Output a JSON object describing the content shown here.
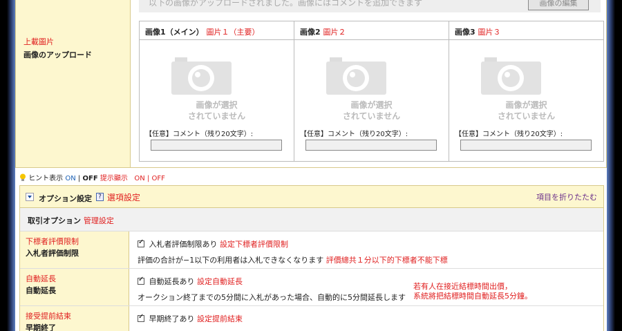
{
  "upload": {
    "label_zh": "上載圖片",
    "label_ja": "画像のアップロード",
    "notice": "以下の画像がアップロードされました。画像にはコメントを追加できます",
    "edit_button": "画像の編集",
    "images": [
      {
        "title": "画像1（メイン）",
        "title_zh": "圖片１（主要）",
        "placeholder": [
          "画像が選択",
          "されていません"
        ],
        "comment_label": "【任意】コメント（残り20文字）:"
      },
      {
        "title": "画像2",
        "title_zh": "圖片２",
        "placeholder": [
          "画像が選択",
          "されていません"
        ],
        "comment_label": "【任意】コメント（残り20文字）:"
      },
      {
        "title": "画像3",
        "title_zh": "圖片３",
        "placeholder": [
          "画像が選択",
          "されていません"
        ],
        "comment_label": "【任意】コメント（残り20文字）:"
      }
    ]
  },
  "hint": {
    "label": "ヒント表示",
    "on": "ON",
    "sep": "|",
    "off": "OFF",
    "label_zh": "提示顯示",
    "on_zh": "ON",
    "off_zh": "OFF"
  },
  "options": {
    "title": "オプション設定",
    "help": "?",
    "title_zh": "選項設定",
    "collapse": "項目を折りたたむ",
    "section": "取引オプション",
    "section_zh": "管理設定",
    "rows": [
      {
        "label_zh": "下標者評價限制",
        "label_ja": "入札者評価制限",
        "check_label": "入札者評価制限あり",
        "check_zh": "設定下標者評價限制",
        "desc": "評価の合計が−1以下の利用者は入札できなくなります",
        "desc_zh": "評價總共１分以下的下標者不能下標",
        "note": []
      },
      {
        "label_zh": "自動延長",
        "label_ja": "自動延長",
        "check_label": "自動延長あり",
        "check_zh": "設定自動延長",
        "desc": "オークション終了までの5分間に入札があった場合、自動的に5分間延長します",
        "desc_zh": "",
        "note": [
          "若有人在接近結標時間出價，",
          "系統將把結標時間自動延長5分鐘。"
        ]
      },
      {
        "label_zh": "接受提前結束",
        "label_ja": "早期終了",
        "check_label": "早期終了あり",
        "check_zh": "設定提前結束",
        "desc": "",
        "desc_zh": "",
        "note": []
      }
    ]
  }
}
